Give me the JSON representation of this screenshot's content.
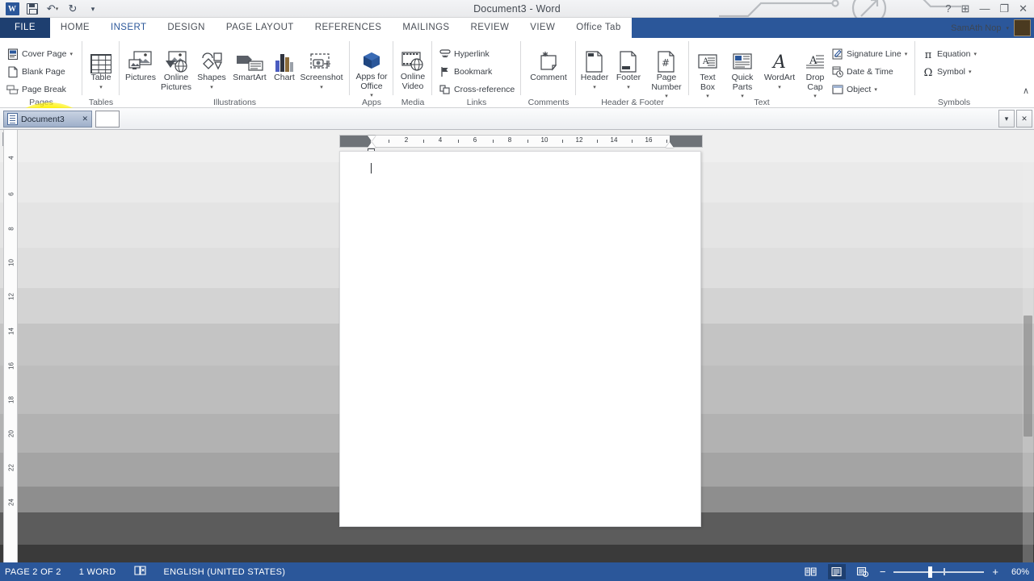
{
  "window": {
    "title": "Document3 - Word",
    "quick_access": [
      {
        "name": "word-logo-icon",
        "label": "W"
      },
      {
        "name": "save-icon",
        "label": "Save"
      },
      {
        "name": "undo-icon",
        "label": "Undo"
      },
      {
        "name": "redo-icon",
        "label": "Redo"
      },
      {
        "name": "customize-qat-icon",
        "label": "Customize Quick Access Toolbar"
      }
    ],
    "controls": [
      {
        "name": "help-button",
        "glyph": "?"
      },
      {
        "name": "ribbon-display-options-button",
        "glyph": "⬒"
      },
      {
        "name": "minimize-button",
        "glyph": "—"
      },
      {
        "name": "restore-button",
        "glyph": "❐"
      },
      {
        "name": "close-button",
        "glyph": "✕"
      }
    ],
    "user_name": "SamAth Nop"
  },
  "ribbon_tabs": [
    {
      "label": "FILE",
      "active": false,
      "kind": "file"
    },
    {
      "label": "HOME",
      "active": false,
      "kind": "normal"
    },
    {
      "label": "INSERT",
      "active": true,
      "kind": "normal"
    },
    {
      "label": "DESIGN",
      "active": false,
      "kind": "normal"
    },
    {
      "label": "PAGE LAYOUT",
      "active": false,
      "kind": "normal"
    },
    {
      "label": "REFERENCES",
      "active": false,
      "kind": "normal"
    },
    {
      "label": "MAILINGS",
      "active": false,
      "kind": "normal"
    },
    {
      "label": "REVIEW",
      "active": false,
      "kind": "normal"
    },
    {
      "label": "VIEW",
      "active": false,
      "kind": "normal"
    },
    {
      "label": "Office Tab",
      "active": false,
      "kind": "normal"
    }
  ],
  "ribbon": {
    "collapse_label": "∧",
    "groups": [
      {
        "name": "pages",
        "label": "Pages",
        "items": [
          {
            "label": "Cover Page",
            "dropdown": true
          },
          {
            "label": "Blank Page",
            "dropdown": false
          },
          {
            "label": "Page Break",
            "dropdown": false,
            "highlighted": true
          }
        ]
      },
      {
        "name": "tables",
        "label": "Tables",
        "items": [
          {
            "label": "Table",
            "dropdown": true
          }
        ]
      },
      {
        "name": "illustrations",
        "label": "Illustrations",
        "items": [
          {
            "label": "Pictures",
            "dropdown": false
          },
          {
            "label": "Online\nPictures",
            "dropdown": false
          },
          {
            "label": "Shapes",
            "dropdown": true
          },
          {
            "label": "SmartArt",
            "dropdown": false
          },
          {
            "label": "Chart",
            "dropdown": false
          },
          {
            "label": "Screenshot",
            "dropdown": true
          }
        ]
      },
      {
        "name": "apps",
        "label": "Apps",
        "items": [
          {
            "label": "Apps for\nOffice",
            "dropdown": true
          }
        ]
      },
      {
        "name": "media",
        "label": "Media",
        "items": [
          {
            "label": "Online\nVideo",
            "dropdown": false
          }
        ]
      },
      {
        "name": "links",
        "label": "Links",
        "items": [
          {
            "label": "Hyperlink",
            "dropdown": false
          },
          {
            "label": "Bookmark",
            "dropdown": false
          },
          {
            "label": "Cross-reference",
            "dropdown": false
          }
        ]
      },
      {
        "name": "comments",
        "label": "Comments",
        "items": [
          {
            "label": "Comment",
            "dropdown": false
          }
        ]
      },
      {
        "name": "header-footer",
        "label": "Header & Footer",
        "items": [
          {
            "label": "Header",
            "dropdown": true
          },
          {
            "label": "Footer",
            "dropdown": true
          },
          {
            "label": "Page\nNumber",
            "dropdown": true
          }
        ]
      },
      {
        "name": "text",
        "label": "Text",
        "items": [
          {
            "label": "Text\nBox",
            "dropdown": true
          },
          {
            "label": "Quick\nParts",
            "dropdown": true
          },
          {
            "label": "WordArt",
            "dropdown": true
          },
          {
            "label": "Drop\nCap",
            "dropdown": true
          },
          {
            "label": "Signature Line",
            "dropdown": true
          },
          {
            "label": "Date & Time",
            "dropdown": false
          },
          {
            "label": "Object",
            "dropdown": true
          }
        ]
      },
      {
        "name": "symbols",
        "label": "Symbols",
        "items": [
          {
            "label": "Equation",
            "dropdown": true
          },
          {
            "label": "Symbol",
            "dropdown": true
          }
        ]
      }
    ]
  },
  "office_tab_bar": {
    "tabs": [
      {
        "label": "Document3",
        "active": true,
        "close_glyph": "✕"
      }
    ],
    "new_tab_label": "",
    "right_buttons": [
      {
        "name": "office-tab-list-button",
        "glyph": "▾"
      },
      {
        "name": "office-tab-close-button",
        "glyph": "✕"
      }
    ]
  },
  "rulers": {
    "corner_label": "L",
    "horizontal_ticks": [
      "2",
      "4",
      "6",
      "8",
      "10",
      "12",
      "14",
      "16"
    ],
    "vertical_ticks": [
      "4",
      "6",
      "8",
      "10",
      "12",
      "14",
      "16",
      "18",
      "20",
      "22",
      "24"
    ]
  },
  "document": {
    "page_content": "",
    "page_label": "Page 2"
  },
  "status_bar": {
    "page_indicator": "PAGE 2 OF 2",
    "word_count": "1 WORD",
    "proofing_icon": "proofing-errors-icon",
    "language": "ENGLISH (UNITED STATES)",
    "view_buttons": [
      {
        "name": "read-mode-button",
        "active": false
      },
      {
        "name": "print-layout-button",
        "active": true
      },
      {
        "name": "web-layout-button",
        "active": false
      }
    ],
    "zoom_out_label": "−",
    "zoom_in_label": "+",
    "zoom_level": "60%"
  },
  "colors": {
    "accent": "#2b579a",
    "file_tab": "#1e3f70",
    "highlight": "#fff200",
    "ribbon_bg": "#ffffff",
    "status_text": "#ffffff"
  }
}
